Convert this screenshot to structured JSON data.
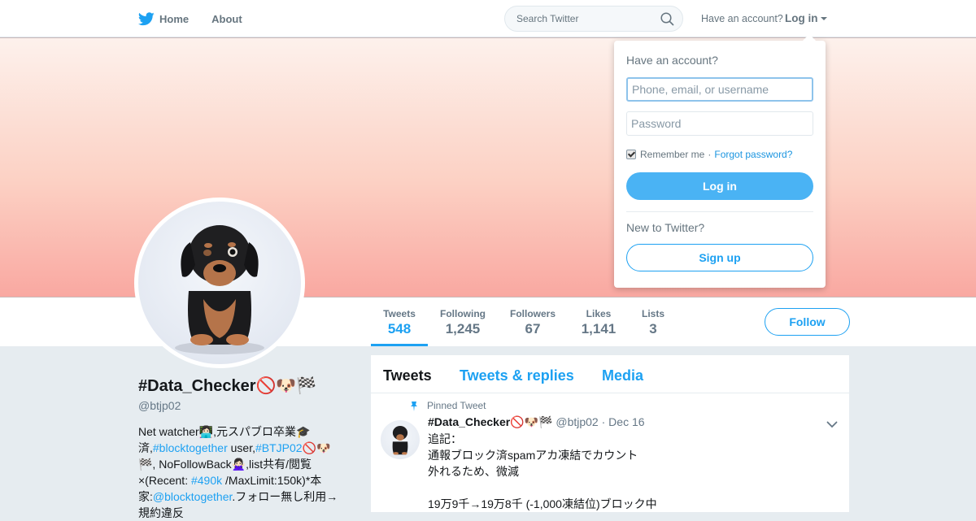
{
  "nav": {
    "home_label": "Home",
    "about_label": "About",
    "search_placeholder": "Search Twitter",
    "have_account": "Have an account?",
    "login_label": "Log in"
  },
  "profile": {
    "name": "#Data_Checker🚫🐶🏁",
    "handle": "@btjp02",
    "bio": [
      {
        "text": "Net watcher👩🏻‍💻,元スパブロ卒業🎓済,",
        "link": false
      },
      {
        "text": "#blocktogether",
        "link": true
      },
      {
        "text": " user,",
        "link": false
      },
      {
        "text": "#BTJP02",
        "link": true
      },
      {
        "text": "🚫🐶🏁, NoFollowBack🙅🏻‍♀️,list共有/閲覧×(Recent: ",
        "link": false
      },
      {
        "text": "#490k",
        "link": true
      },
      {
        "text": " /MaxLimit:150k)*本家:",
        "link": false
      },
      {
        "text": "@blocktogether",
        "link": true
      },
      {
        "text": ".フォロー無し利用→規約違反",
        "link": false
      }
    ]
  },
  "stats": [
    {
      "label": "Tweets",
      "value": "548",
      "active": true
    },
    {
      "label": "Following",
      "value": "1,245",
      "active": false
    },
    {
      "label": "Followers",
      "value": "67",
      "active": false
    },
    {
      "label": "Likes",
      "value": "1,141",
      "active": false
    },
    {
      "label": "Lists",
      "value": "3",
      "active": false
    }
  ],
  "follow_label": "Follow",
  "timeline": {
    "tabs": [
      "Tweets",
      "Tweets & replies",
      "Media"
    ],
    "active_tab": 0,
    "pinned_label": "Pinned Tweet",
    "tweet": {
      "name": "#Data_Checker🚫🐶🏁",
      "handle": "@btjp02",
      "sep": "·",
      "date": "Dec 16",
      "text": "追記：\n通報ブロック済spamアカ凍結でカウント\n外れるため、微減\n\n19万9千→19万8千 (-1,000凍結位)ブロック中"
    }
  },
  "login_dropdown": {
    "title": "Have an account?",
    "username_placeholder": "Phone, email, or username",
    "password_placeholder": "Password",
    "remember_label": "Remember me",
    "sep": "·",
    "forgot_label": "Forgot password?",
    "login_button": "Log in",
    "new_label": "New to Twitter?",
    "signup_button": "Sign up"
  },
  "colors": {
    "accent": "#1da1f2",
    "login_button": "#4ab3f4",
    "page_background": "#e6ecf0"
  }
}
